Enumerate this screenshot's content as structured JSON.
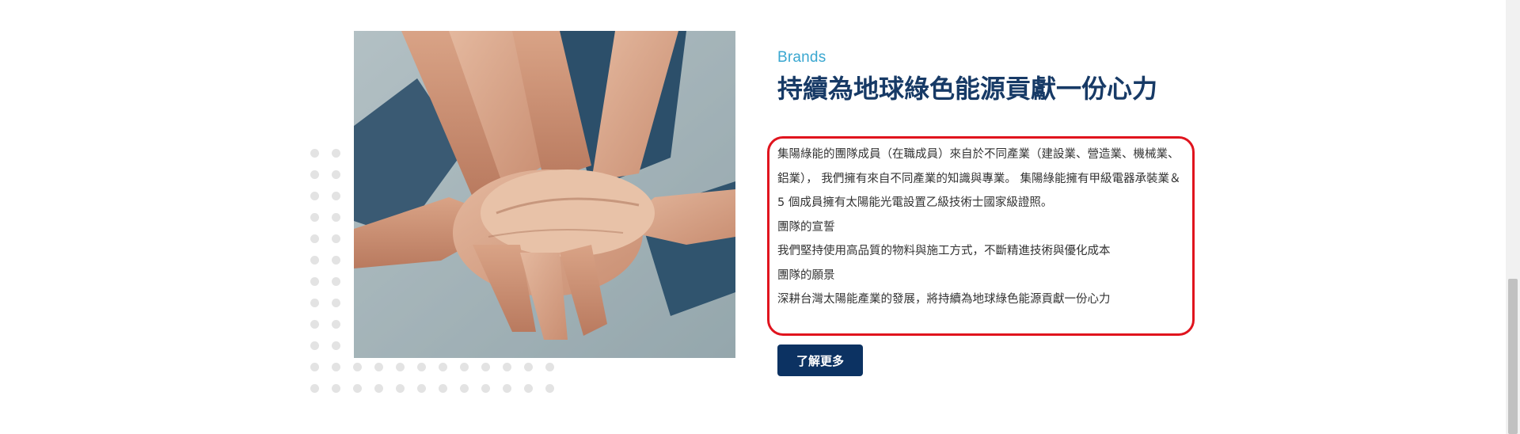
{
  "section": {
    "eyebrow": "Brands",
    "title": "持續為地球綠色能源貢獻一份心力",
    "paragraphs": [
      "集陽綠能的團隊成員（在職成員）來自於不同產業（建設業、營造業、機械業、鋁業）， 我們擁有來自不同產業的知識與專業。 集陽綠能擁有甲級電器承裝業＆ 5 個成員擁有太陽能光電設置乙級技術士國家級證照。",
      "團隊的宣誓",
      "我們堅持使用高品質的物料與施工方式，不斷精進技術與優化成本",
      "團隊的願景",
      "深耕台灣太陽能產業的發展，將持續為地球綠色能源貢獻一份心力"
    ],
    "cta_label": "了解更多"
  },
  "colors": {
    "eyebrow": "#3aa7d0",
    "title": "#173a66",
    "button": "#0c3262",
    "highlight_outline": "#e0141e"
  }
}
